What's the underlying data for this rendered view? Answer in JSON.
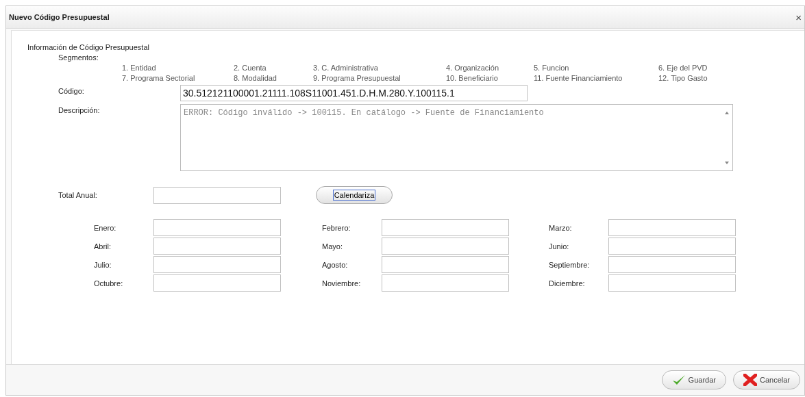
{
  "window": {
    "title": "Nuevo Código Presupuestal",
    "close": "×"
  },
  "section_title": "Información de Código Presupuestal",
  "segments_label": "Segmentos:",
  "segments": [
    "1. Entidad",
    "2. Cuenta",
    "3. C. Administrativa",
    "4. Organización",
    "5. Funcion",
    "6. Eje del PVD",
    "7. Programa Sectorial",
    "8. Modalidad",
    "9. Programa Presupuestal",
    "10. Beneficiario",
    "11. Fuente Financiamiento",
    "12. Tipo Gasto"
  ],
  "codigo": {
    "label": "Código:",
    "value": "30.512121100001.21111.108S11001.451.D.H.M.280.Y.100115.1"
  },
  "descripcion": {
    "label": "Descripción:",
    "value": "ERROR: Código inválido -> 100115. En catálogo -> Fuente de Financiamiento"
  },
  "total_anual": {
    "label": "Total Anual:"
  },
  "calendariza_button": "Calendariza",
  "months": [
    {
      "label": "Enero:"
    },
    {
      "label": "Febrero:"
    },
    {
      "label": "Marzo:"
    },
    {
      "label": "Abril:"
    },
    {
      "label": "Mayo:"
    },
    {
      "label": "Junio:"
    },
    {
      "label": "Julio:"
    },
    {
      "label": "Agosto:"
    },
    {
      "label": "Septiembre:"
    },
    {
      "label": "Octubre:"
    },
    {
      "label": "Noviembre:"
    },
    {
      "label": "Diciembre:"
    }
  ],
  "buttons": [
    {
      "label": "Guardar",
      "kind": "save"
    },
    {
      "label": "Cancelar",
      "kind": "cancel"
    }
  ]
}
